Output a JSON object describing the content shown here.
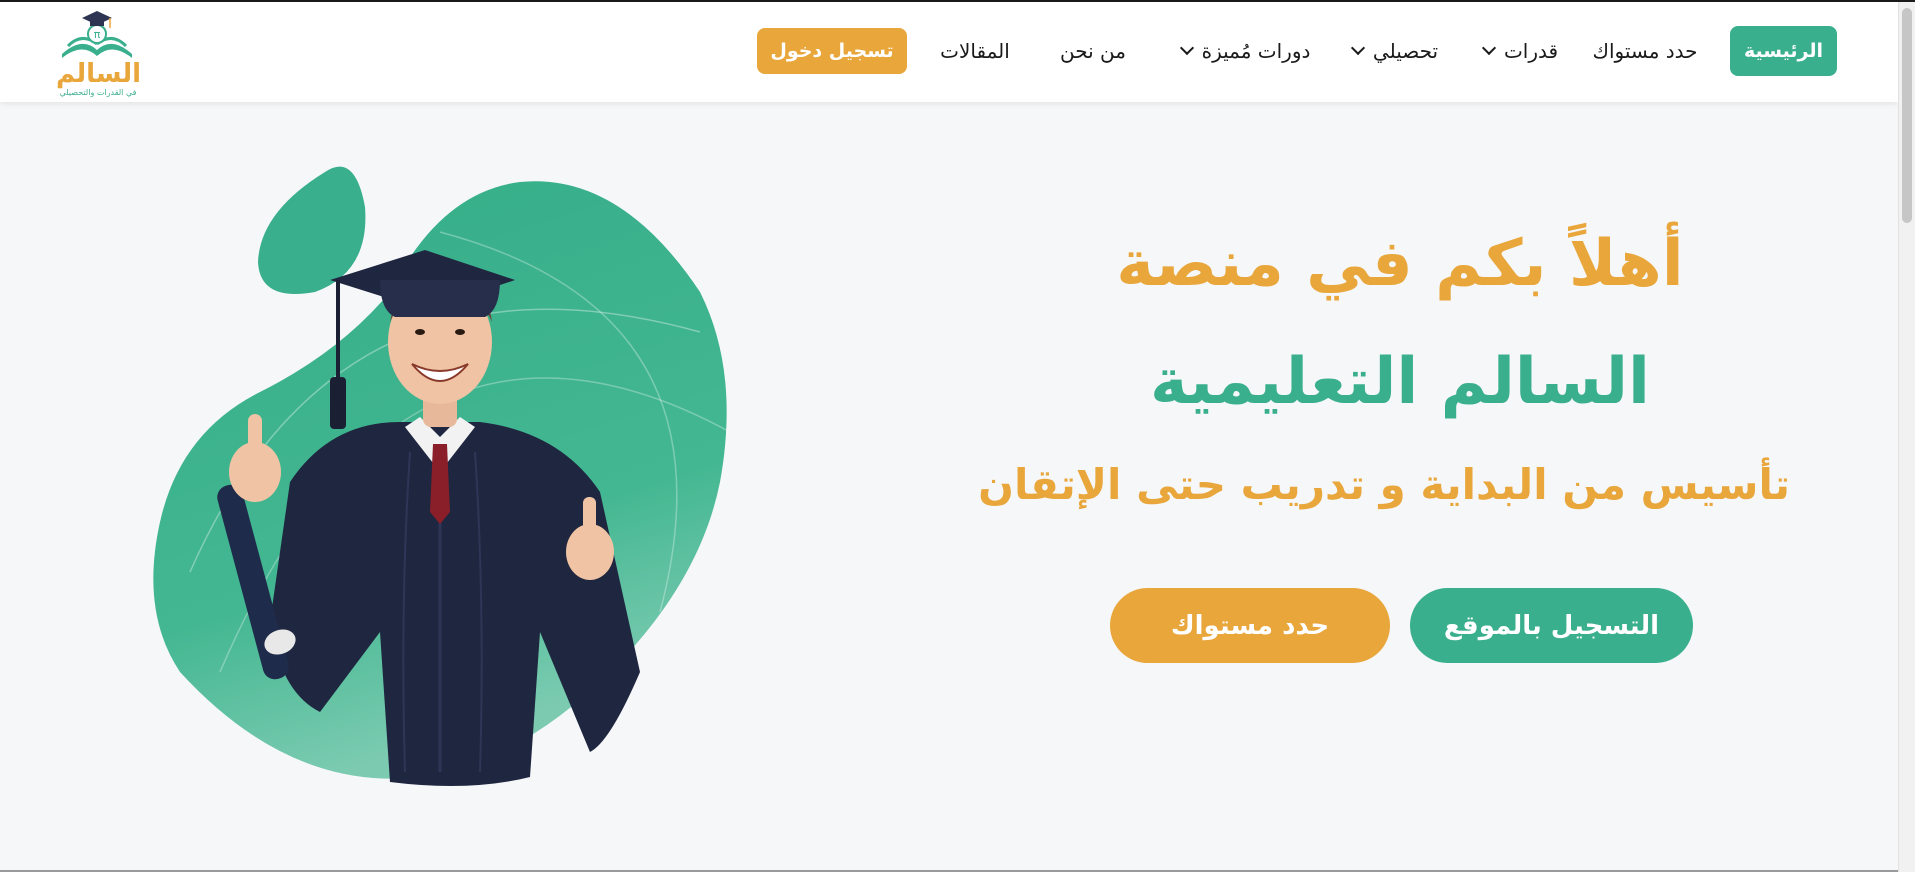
{
  "brand": {
    "logo_text": "السالم",
    "logo_subtext": "في القدرات والتحصيلي"
  },
  "nav": {
    "home": "الرئيسية",
    "level": "حدد مستواك",
    "qudrat": "قدرات",
    "tahsili": "تحصيلي",
    "courses": "دورات مُميزة",
    "about": "من نحن",
    "articles": "المقالات",
    "login": "تسجيل دخول"
  },
  "hero": {
    "line1": "أهلاً بكم في منصة",
    "line2": "السالم التعليمية",
    "tagline": "تأسيس من البداية و تدريب حتى الإتقان",
    "register_button": "التسجيل بالموقع",
    "level_button": "حدد مستواك"
  },
  "colors": {
    "green": "#3aaf8d",
    "orange": "#e8a63b",
    "background": "#f6f7f9"
  },
  "icons": {
    "dropdown": "chevron-down-icon",
    "logo": "graduation-cap-book-icon"
  }
}
